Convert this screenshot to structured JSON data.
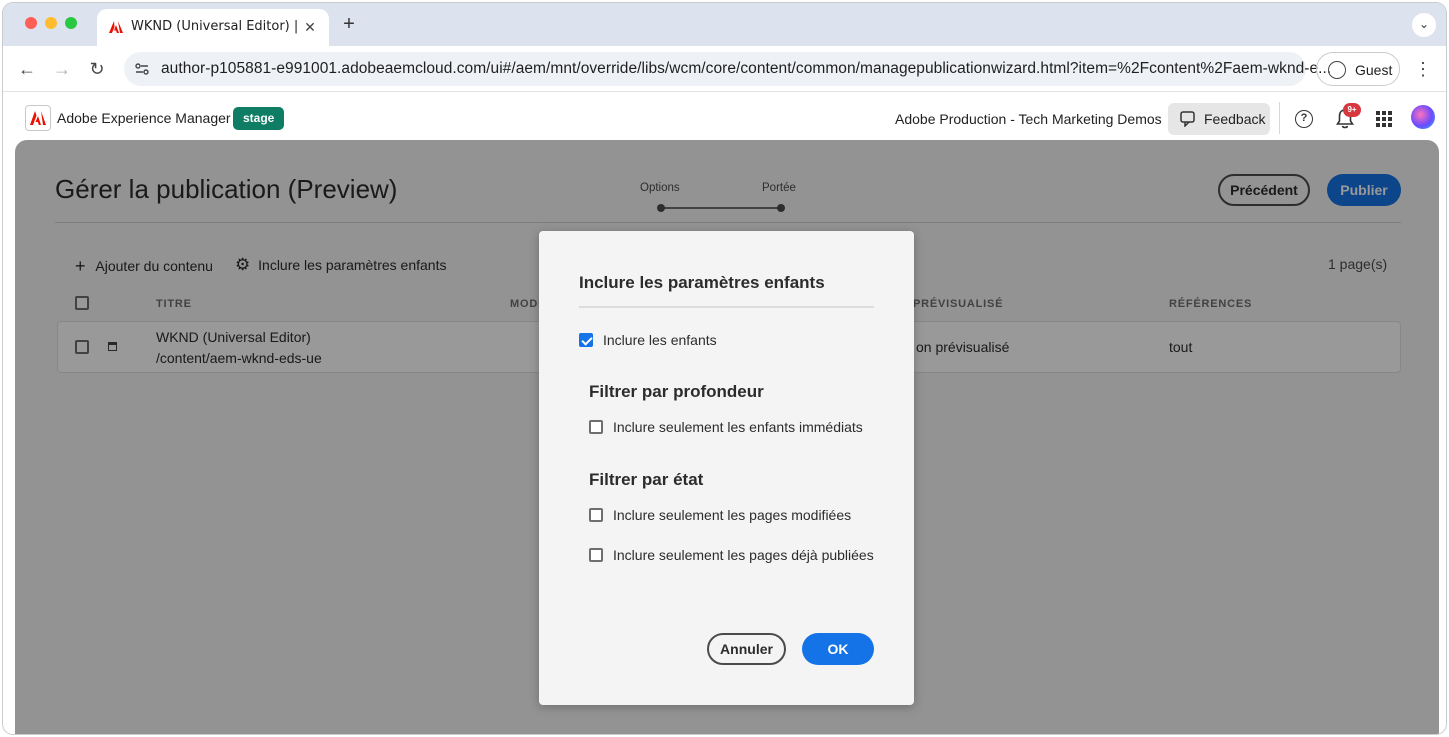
{
  "browser": {
    "tab_title": "WKND (Universal Editor) | Adobe Experience Manager",
    "url": "author-p105881-e991001.adobeaemcloud.com/ui#/aem/mnt/override/libs/wcm/core/content/common/managepublicationwizard.html?item=%2Fcontent%2Faem-wknd-e...",
    "profile_label": "Guest"
  },
  "shell": {
    "product": "Adobe Experience Manager",
    "env_badge": "stage",
    "org": "Adobe Production - Tech Marketing Demos",
    "feedback_label": "Feedback",
    "notifications_badge": "9+"
  },
  "page": {
    "title": "Gérer la publication (Preview)",
    "steps": [
      "Options",
      "Portée"
    ],
    "prev_label": "Précédent",
    "publish_label": "Publier",
    "actions": {
      "add_content": "Ajouter du contenu",
      "include_children": "Inclure les paramètres enfants"
    },
    "page_count": "1 page(s)",
    "columns": {
      "title": "TITRE",
      "modified": "MODI",
      "previewed": "PRÉVISUALISÉ",
      "references": "RÉFÉRENCES"
    },
    "row": {
      "title": "WKND (Universal Editor)",
      "path": "/content/aem-wknd-eds-ue",
      "previewed": "on prévisualisé",
      "references": "tout"
    }
  },
  "dialog": {
    "title": "Inclure les paramètres enfants",
    "include_children": {
      "label": "Inclure les enfants",
      "checked": true
    },
    "depth_heading": "Filtrer par profondeur",
    "immediate_children": {
      "label": "Inclure seulement les enfants immédiats",
      "checked": false
    },
    "state_heading": "Filtrer par état",
    "modified_pages": {
      "label": "Inclure seulement les pages modifiées",
      "checked": false
    },
    "published_pages": {
      "label": "Inclure seulement les pages déjà publiées",
      "checked": false
    },
    "cancel_label": "Annuler",
    "ok_label": "OK"
  }
}
